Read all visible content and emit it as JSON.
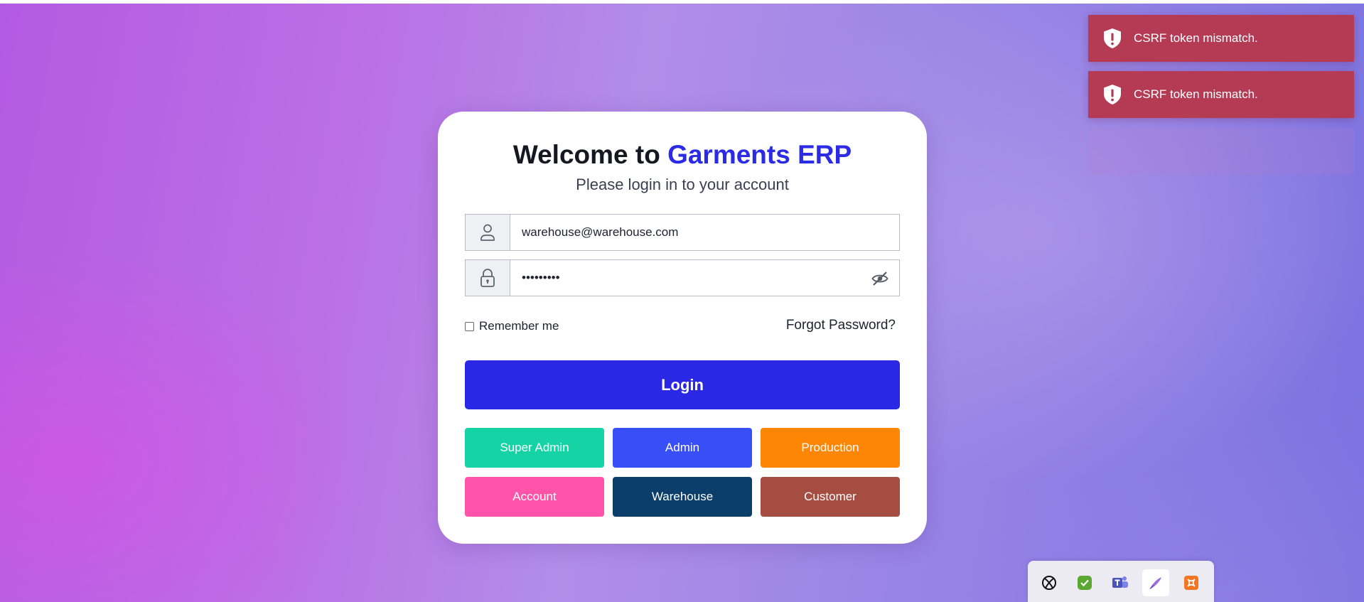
{
  "login": {
    "title_prefix": "Welcome to ",
    "title_brand": "Garments ERP",
    "subtitle": "Please login in to your account",
    "email_value": "warehouse@warehouse.com",
    "password_value": "•••••••••",
    "remember_label": "Remember me",
    "forgot_label": "Forgot Password?",
    "login_label": "Login"
  },
  "roles": [
    {
      "label": "Super Admin",
      "color": "#16d3a5"
    },
    {
      "label": "Admin",
      "color": "#384ff8"
    },
    {
      "label": "Production",
      "color": "#fd8605"
    },
    {
      "label": "Account",
      "color": "#fe53a9"
    },
    {
      "label": "Warehouse",
      "color": "#0b3e6b"
    },
    {
      "label": "Customer",
      "color": "#a44d40"
    }
  ],
  "toasts": [
    {
      "message": "CSRF token mismatch.",
      "icon": "shield-alert-icon"
    },
    {
      "message": "CSRF token mismatch.",
      "icon": "shield-alert-icon"
    }
  ],
  "tray": {
    "icons": [
      "xbox-icon",
      "security-check-icon",
      "teams-icon",
      "pen-icon",
      "xampp-icon"
    ]
  },
  "colors": {
    "brand": "#2b2be6",
    "login_button": "#2a28e4",
    "toast_bg": "#b53b55"
  }
}
